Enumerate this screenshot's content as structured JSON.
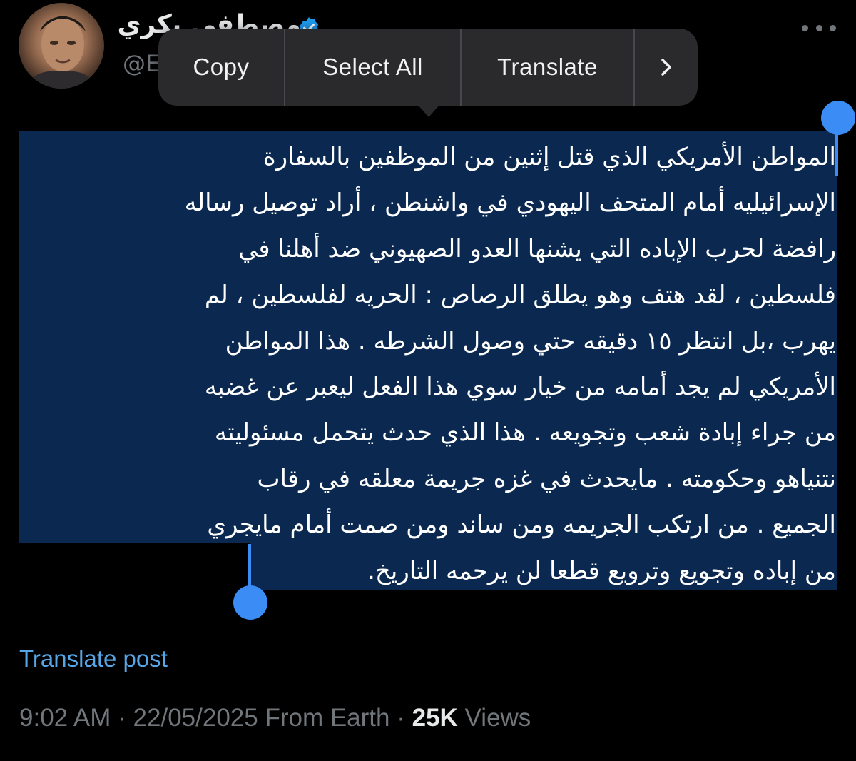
{
  "author": {
    "name": "مصطفى بكري",
    "handle": "@E",
    "avatar_icon": "avatar-photo",
    "verified_icon": "verified-badge-icon"
  },
  "context_menu": {
    "items": [
      "Copy",
      "Select All",
      "Translate"
    ],
    "more_icon": "chevron-right-icon"
  },
  "post": {
    "lines": [
      "المواطن الأمريكي الذي قتل إثنين من الموظفين بالسفارة",
      "الإسرائيليه أمام المتحف اليهودي في واشنطن ، أراد توصيل رساله",
      "رافضة لحرب الإباده التي يشنها العدو الصهيوني ضد أهلنا في",
      "فلسطين ، لقد هتف وهو يطلق الرصاص : الحريه لفلسطين ، لم",
      "يهرب ،بل انتظر ١٥ دقيقه حتي وصول الشرطه . هذا المواطن",
      "الأمريكي لم يجد أمامه من خيار سوي هذا الفعل ليعبر عن غضبه",
      "من جراء إبادة شعب وتجويعه . هذا الذي حدث يتحمل مسئوليته",
      "نتنياهو وحكومته . مايحدث في غزه جريمة معلقه في رقاب",
      "الجميع . من ارتكب الجريمه ومن ساند ومن صمت أمام مايجري",
      "من إباده وتجويع وترويع قطعا لن يرحمه التاريخ."
    ]
  },
  "translate_link": "Translate post",
  "meta": {
    "time": "9:02 AM",
    "separator": "·",
    "date": "22/05/2025",
    "source": "From Earth",
    "views_count": "25K",
    "views_label": "Views"
  },
  "colors": {
    "background": "#000000",
    "selection": "#0b2950",
    "handle": "#3b8cf5",
    "link": "#57a6e8",
    "muted": "#71767b",
    "menu": "#2a2a2d"
  }
}
